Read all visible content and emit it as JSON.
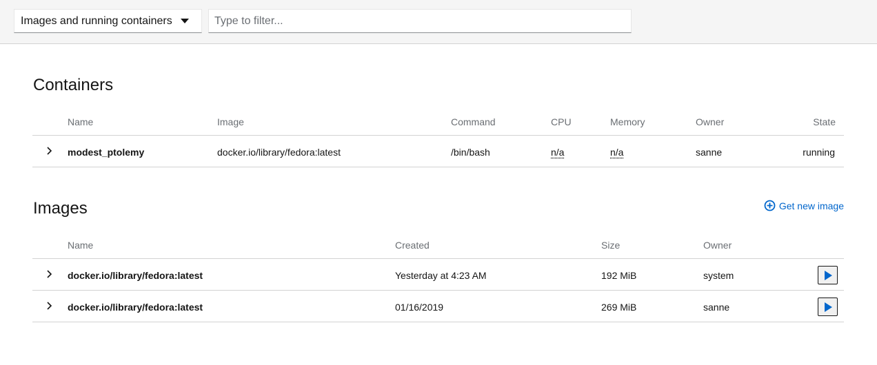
{
  "toolbar": {
    "select_value": "Images and running containers",
    "filter_placeholder": "Type to filter..."
  },
  "containers": {
    "title": "Containers",
    "columns": [
      "Name",
      "Image",
      "Command",
      "CPU",
      "Memory",
      "Owner",
      "State"
    ],
    "rows": [
      {
        "name": "modest_ptolemy",
        "image": "docker.io/library/fedora:latest",
        "command": "/bin/bash",
        "cpu": "n/a",
        "memory": "n/a",
        "owner": "sanne",
        "state": "running"
      }
    ]
  },
  "images": {
    "title": "Images",
    "get_new_label": "Get new image",
    "columns": [
      "Name",
      "Created",
      "Size",
      "Owner"
    ],
    "rows": [
      {
        "name": "docker.io/library/fedora:latest",
        "created": "Yesterday at 4:23 AM",
        "size": "192 MiB",
        "owner": "system"
      },
      {
        "name": "docker.io/library/fedora:latest",
        "created": "01/16/2019",
        "size": "269 MiB",
        "owner": "sanne"
      }
    ]
  },
  "colors": {
    "link": "#0066cc",
    "muted": "#6a6e73",
    "border": "#d2d2d2"
  }
}
